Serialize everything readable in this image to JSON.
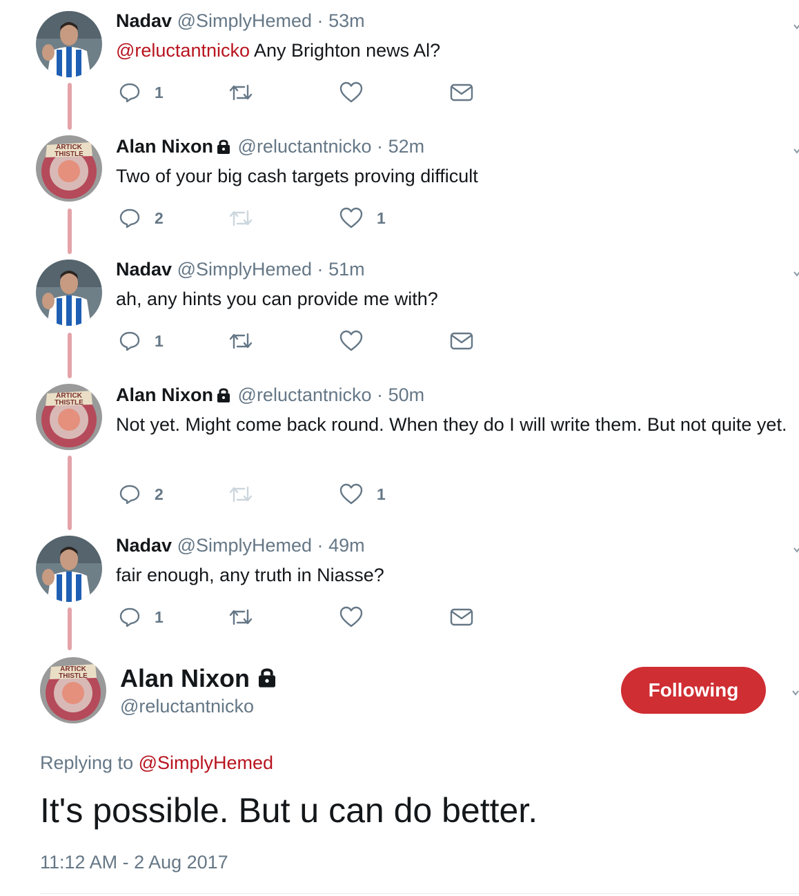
{
  "thread": [
    {
      "name": "Nadav",
      "verified_lock": false,
      "handle": "@SimplyHemed",
      "dot": "·",
      "time": "53m",
      "mention": "@reluctantnicko",
      "text": " Any Brighton news Al?",
      "avatar": "brighton-player",
      "replies": "1",
      "retweets": "",
      "likes": "",
      "has_dm": true,
      "retweet_disabled": false
    },
    {
      "name": "Alan Nixon",
      "verified_lock": true,
      "handle": "@reluctantnicko",
      "dot": "·",
      "time": "52m",
      "mention": "",
      "text": "Two of your big cash targets proving difficult",
      "avatar": "partick-thistle",
      "replies": "2",
      "retweets": "",
      "likes": "1",
      "has_dm": false,
      "retweet_disabled": true
    },
    {
      "name": "Nadav",
      "verified_lock": false,
      "handle": "@SimplyHemed",
      "dot": "·",
      "time": "51m",
      "mention": "",
      "text": "ah, any hints you can provide me with?",
      "avatar": "brighton-player",
      "replies": "1",
      "retweets": "",
      "likes": "",
      "has_dm": true,
      "retweet_disabled": false
    },
    {
      "name": "Alan Nixon",
      "verified_lock": true,
      "handle": "@reluctantnicko",
      "dot": "·",
      "time": "50m",
      "mention": "",
      "text": "Not yet. Might come back round. When they do I will write them. But not quite yet.",
      "avatar": "partick-thistle",
      "replies": "2",
      "retweets": "",
      "likes": "1",
      "has_dm": false,
      "retweet_disabled": true
    },
    {
      "name": "Nadav",
      "verified_lock": false,
      "handle": "@SimplyHemed",
      "dot": "·",
      "time": "49m",
      "mention": "",
      "text": "fair enough, any truth in Niasse?",
      "avatar": "brighton-player",
      "replies": "1",
      "retweets": "",
      "likes": "",
      "has_dm": true,
      "retweet_disabled": false
    }
  ],
  "main_tweet": {
    "name": "Alan Nixon",
    "handle": "@reluctantnicko",
    "follow_label": "Following",
    "replying_prefix": "Replying to ",
    "replying_to": "@SimplyHemed",
    "text": "It's possible. But u can do better.",
    "timestamp": "11:12 AM - 2 Aug 2017"
  },
  "colors": {
    "accent": "#b8141f",
    "follow_button": "#cf2e33",
    "thread_line": "#e4a3a9",
    "muted": "#657786"
  }
}
